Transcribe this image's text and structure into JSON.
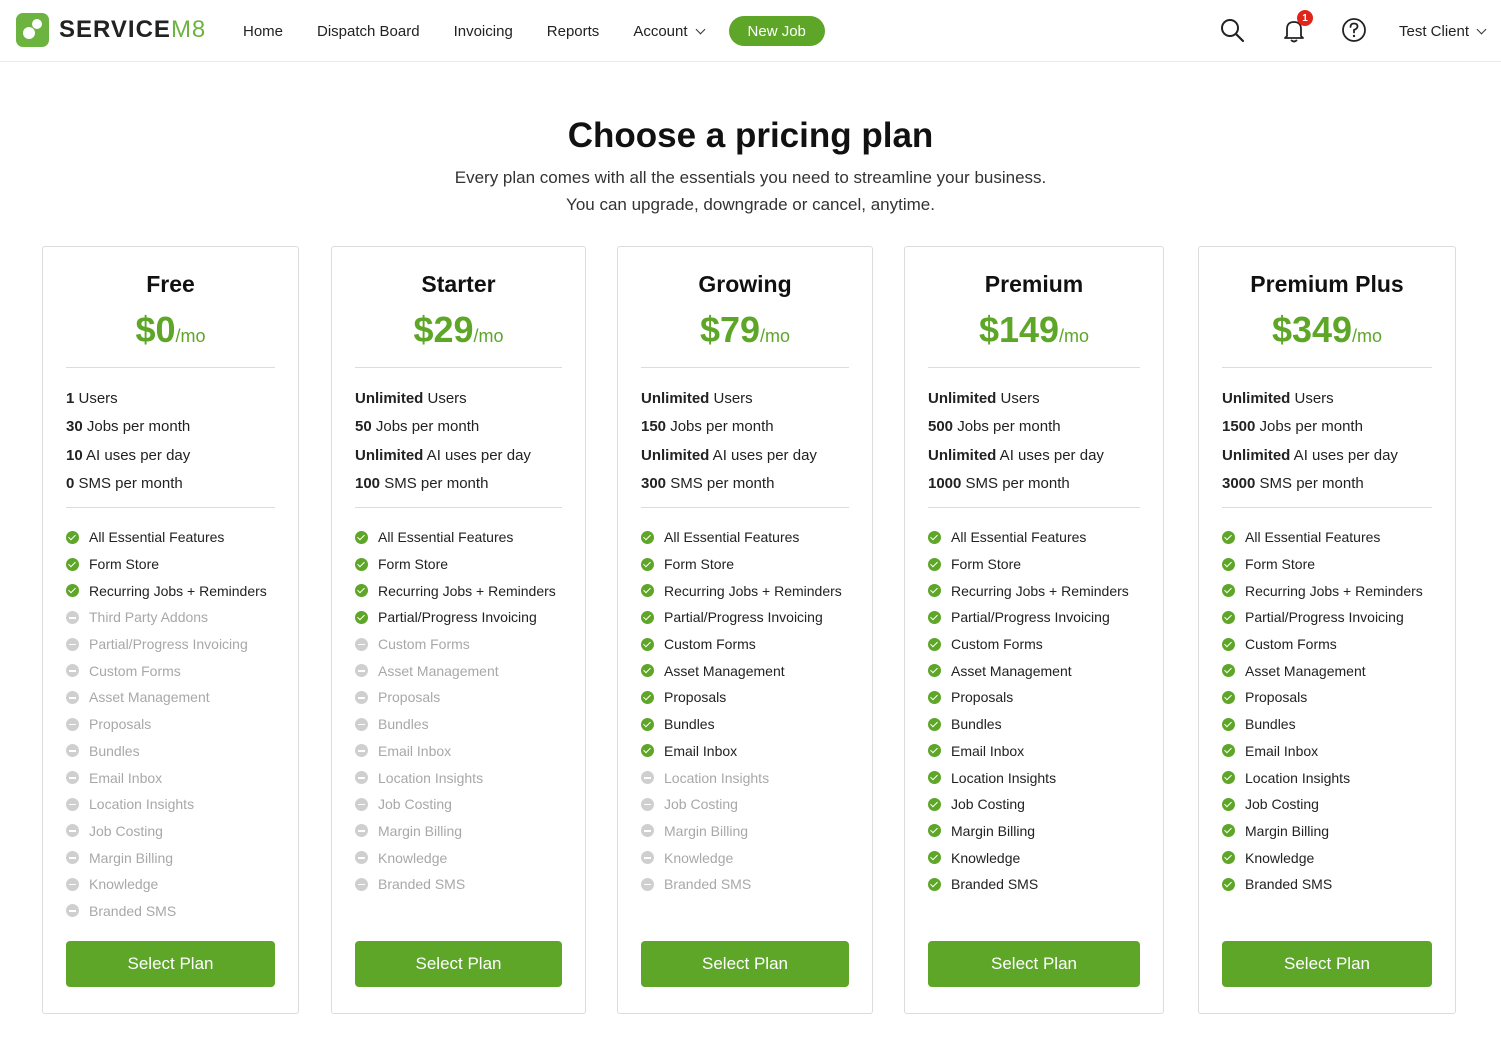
{
  "brand": {
    "name_main": "SERVICE",
    "name_suffix": "M8",
    "accent": "#5da628"
  },
  "nav": {
    "items": [
      "Home",
      "Dispatch Board",
      "Invoicing",
      "Reports"
    ],
    "account": "Account",
    "new_job": "New Job",
    "notifications_count": "1",
    "user": "Test Client"
  },
  "header": {
    "title": "Choose a pricing plan",
    "subtitle_1": "Every plan comes with all the essentials you need to streamline your business.",
    "subtitle_2": "You can upgrade, downgrade or cancel, anytime."
  },
  "per_label": "/mo",
  "select_label": "Select Plan",
  "plans": [
    {
      "name": "Free",
      "price": "$0",
      "limits": [
        {
          "value": "1",
          "label": " Users"
        },
        {
          "value": "30",
          "label": " Jobs per month"
        },
        {
          "value": "10",
          "label": " AI uses per day"
        },
        {
          "value": "0",
          "label": " SMS per month"
        }
      ],
      "features": [
        {
          "label": "All Essential Features",
          "on": true
        },
        {
          "label": "Form Store",
          "on": true
        },
        {
          "label": "Recurring Jobs + Reminders",
          "on": true
        },
        {
          "label": "Third Party Addons",
          "on": false
        },
        {
          "label": "Partial/Progress Invoicing",
          "on": false
        },
        {
          "label": "Custom Forms",
          "on": false
        },
        {
          "label": "Asset Management",
          "on": false
        },
        {
          "label": "Proposals",
          "on": false
        },
        {
          "label": "Bundles",
          "on": false
        },
        {
          "label": "Email Inbox",
          "on": false
        },
        {
          "label": "Location Insights",
          "on": false
        },
        {
          "label": "Job Costing",
          "on": false
        },
        {
          "label": "Margin Billing",
          "on": false
        },
        {
          "label": "Knowledge",
          "on": false
        },
        {
          "label": "Branded SMS",
          "on": false
        }
      ]
    },
    {
      "name": "Starter",
      "price": "$29",
      "limits": [
        {
          "value": "Unlimited",
          "label": " Users"
        },
        {
          "value": "50",
          "label": " Jobs per month"
        },
        {
          "value": "Unlimited",
          "label": " AI uses per day"
        },
        {
          "value": "100",
          "label": " SMS per month"
        }
      ],
      "features": [
        {
          "label": "All Essential Features",
          "on": true
        },
        {
          "label": "Form Store",
          "on": true
        },
        {
          "label": "Recurring Jobs + Reminders",
          "on": true
        },
        {
          "label": "Partial/Progress Invoicing",
          "on": true
        },
        {
          "label": "Custom Forms",
          "on": false
        },
        {
          "label": "Asset Management",
          "on": false
        },
        {
          "label": "Proposals",
          "on": false
        },
        {
          "label": "Bundles",
          "on": false
        },
        {
          "label": "Email Inbox",
          "on": false
        },
        {
          "label": "Location Insights",
          "on": false
        },
        {
          "label": "Job Costing",
          "on": false
        },
        {
          "label": "Margin Billing",
          "on": false
        },
        {
          "label": "Knowledge",
          "on": false
        },
        {
          "label": "Branded SMS",
          "on": false
        }
      ]
    },
    {
      "name": "Growing",
      "price": "$79",
      "limits": [
        {
          "value": "Unlimited",
          "label": " Users"
        },
        {
          "value": "150",
          "label": " Jobs per month"
        },
        {
          "value": "Unlimited",
          "label": " AI uses per day"
        },
        {
          "value": "300",
          "label": " SMS per month"
        }
      ],
      "features": [
        {
          "label": "All Essential Features",
          "on": true
        },
        {
          "label": "Form Store",
          "on": true
        },
        {
          "label": "Recurring Jobs + Reminders",
          "on": true
        },
        {
          "label": "Partial/Progress Invoicing",
          "on": true
        },
        {
          "label": "Custom Forms",
          "on": true
        },
        {
          "label": "Asset Management",
          "on": true
        },
        {
          "label": "Proposals",
          "on": true
        },
        {
          "label": "Bundles",
          "on": true
        },
        {
          "label": "Email Inbox",
          "on": true
        },
        {
          "label": "Location Insights",
          "on": false
        },
        {
          "label": "Job Costing",
          "on": false
        },
        {
          "label": "Margin Billing",
          "on": false
        },
        {
          "label": "Knowledge",
          "on": false
        },
        {
          "label": "Branded SMS",
          "on": false
        }
      ]
    },
    {
      "name": "Premium",
      "price": "$149",
      "limits": [
        {
          "value": "Unlimited",
          "label": " Users"
        },
        {
          "value": "500",
          "label": " Jobs per month"
        },
        {
          "value": "Unlimited",
          "label": " AI uses per day"
        },
        {
          "value": "1000",
          "label": " SMS per month"
        }
      ],
      "features": [
        {
          "label": "All Essential Features",
          "on": true
        },
        {
          "label": "Form Store",
          "on": true
        },
        {
          "label": "Recurring Jobs + Reminders",
          "on": true
        },
        {
          "label": "Partial/Progress Invoicing",
          "on": true
        },
        {
          "label": "Custom Forms",
          "on": true
        },
        {
          "label": "Asset Management",
          "on": true
        },
        {
          "label": "Proposals",
          "on": true
        },
        {
          "label": "Bundles",
          "on": true
        },
        {
          "label": "Email Inbox",
          "on": true
        },
        {
          "label": "Location Insights",
          "on": true
        },
        {
          "label": "Job Costing",
          "on": true
        },
        {
          "label": "Margin Billing",
          "on": true
        },
        {
          "label": "Knowledge",
          "on": true
        },
        {
          "label": "Branded SMS",
          "on": true
        }
      ]
    },
    {
      "name": "Premium Plus",
      "price": "$349",
      "limits": [
        {
          "value": "Unlimited",
          "label": " Users"
        },
        {
          "value": "1500",
          "label": " Jobs per month"
        },
        {
          "value": "Unlimited",
          "label": " AI uses per day"
        },
        {
          "value": "3000",
          "label": " SMS per month"
        }
      ],
      "features": [
        {
          "label": "All Essential Features",
          "on": true
        },
        {
          "label": "Form Store",
          "on": true
        },
        {
          "label": "Recurring Jobs + Reminders",
          "on": true
        },
        {
          "label": "Partial/Progress Invoicing",
          "on": true
        },
        {
          "label": "Custom Forms",
          "on": true
        },
        {
          "label": "Asset Management",
          "on": true
        },
        {
          "label": "Proposals",
          "on": true
        },
        {
          "label": "Bundles",
          "on": true
        },
        {
          "label": "Email Inbox",
          "on": true
        },
        {
          "label": "Location Insights",
          "on": true
        },
        {
          "label": "Job Costing",
          "on": true
        },
        {
          "label": "Margin Billing",
          "on": true
        },
        {
          "label": "Knowledge",
          "on": true
        },
        {
          "label": "Branded SMS",
          "on": true
        }
      ]
    }
  ]
}
